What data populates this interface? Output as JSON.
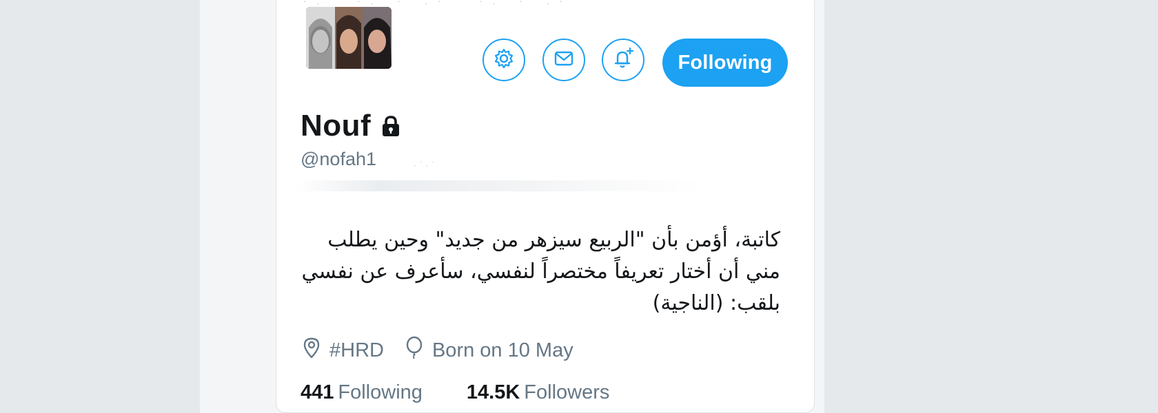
{
  "colors": {
    "accent": "#1da1f2",
    "text_primary": "#14171a",
    "text_secondary": "#657786",
    "card_bg": "#ffffff",
    "page_bg": "#e9ecef"
  },
  "profile": {
    "display_name": "Nouf",
    "handle": "@nofah1",
    "protected_icon": "lock-icon",
    "bio_lines": [
      "كاتبة، أؤمن بأن \"الربيع سيزهر من جديد\" وحين يطلب",
      "مني أن أختار تعريفاً مختصراً لنفسي، سأعرف عن نفسي",
      "بلقب: (الناجية)"
    ]
  },
  "actions": {
    "settings_icon": "gear-icon",
    "message_icon": "envelope-icon",
    "notify_icon": "bell-plus-icon",
    "following_label": "Following"
  },
  "meta": {
    "location_icon": "location-pin-icon",
    "location": "#HRD",
    "birthday_icon": "balloon-icon",
    "birthday": "Born on 10 May"
  },
  "stats": {
    "following_count": "441",
    "following_label": "Following",
    "followers_count": "14.5K",
    "followers_label": "Followers"
  }
}
